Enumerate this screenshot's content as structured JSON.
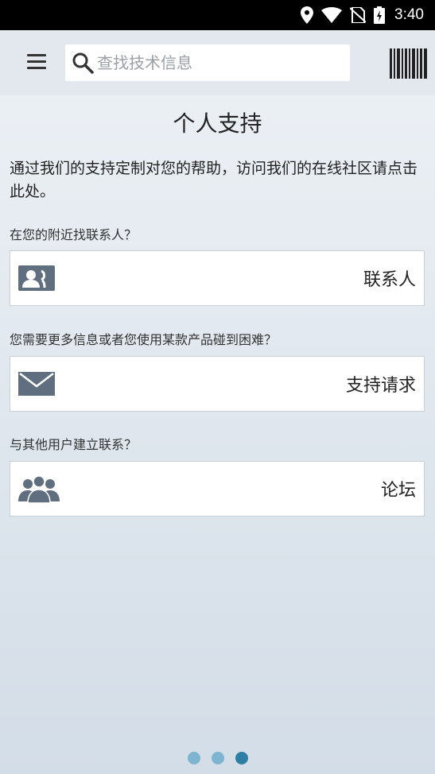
{
  "status_bar": {
    "time": "3:40"
  },
  "toolbar": {
    "search_placeholder": "查找技术信息"
  },
  "page": {
    "title": "个人支持",
    "intro": "通过我们的支持定制对您的帮助，访问我们的在线社区请点击此处。"
  },
  "sections": [
    {
      "label": "在您的附近找联系人？",
      "card_label": "联系人",
      "icon": "contacts-icon"
    },
    {
      "label": "您需要更多信息或者您使用某款产品碰到困难？",
      "card_label": "支持请求",
      "icon": "mail-icon"
    },
    {
      "label": "与其他用户建立联系？",
      "card_label": "论坛",
      "icon": "forum-users-icon"
    }
  ],
  "pager": {
    "count": 3,
    "active_index": 2
  },
  "colors": {
    "icon_gray": "#5f6f80",
    "dot_active": "#2e7fa6",
    "dot_inactive": "#7eb4cf"
  }
}
